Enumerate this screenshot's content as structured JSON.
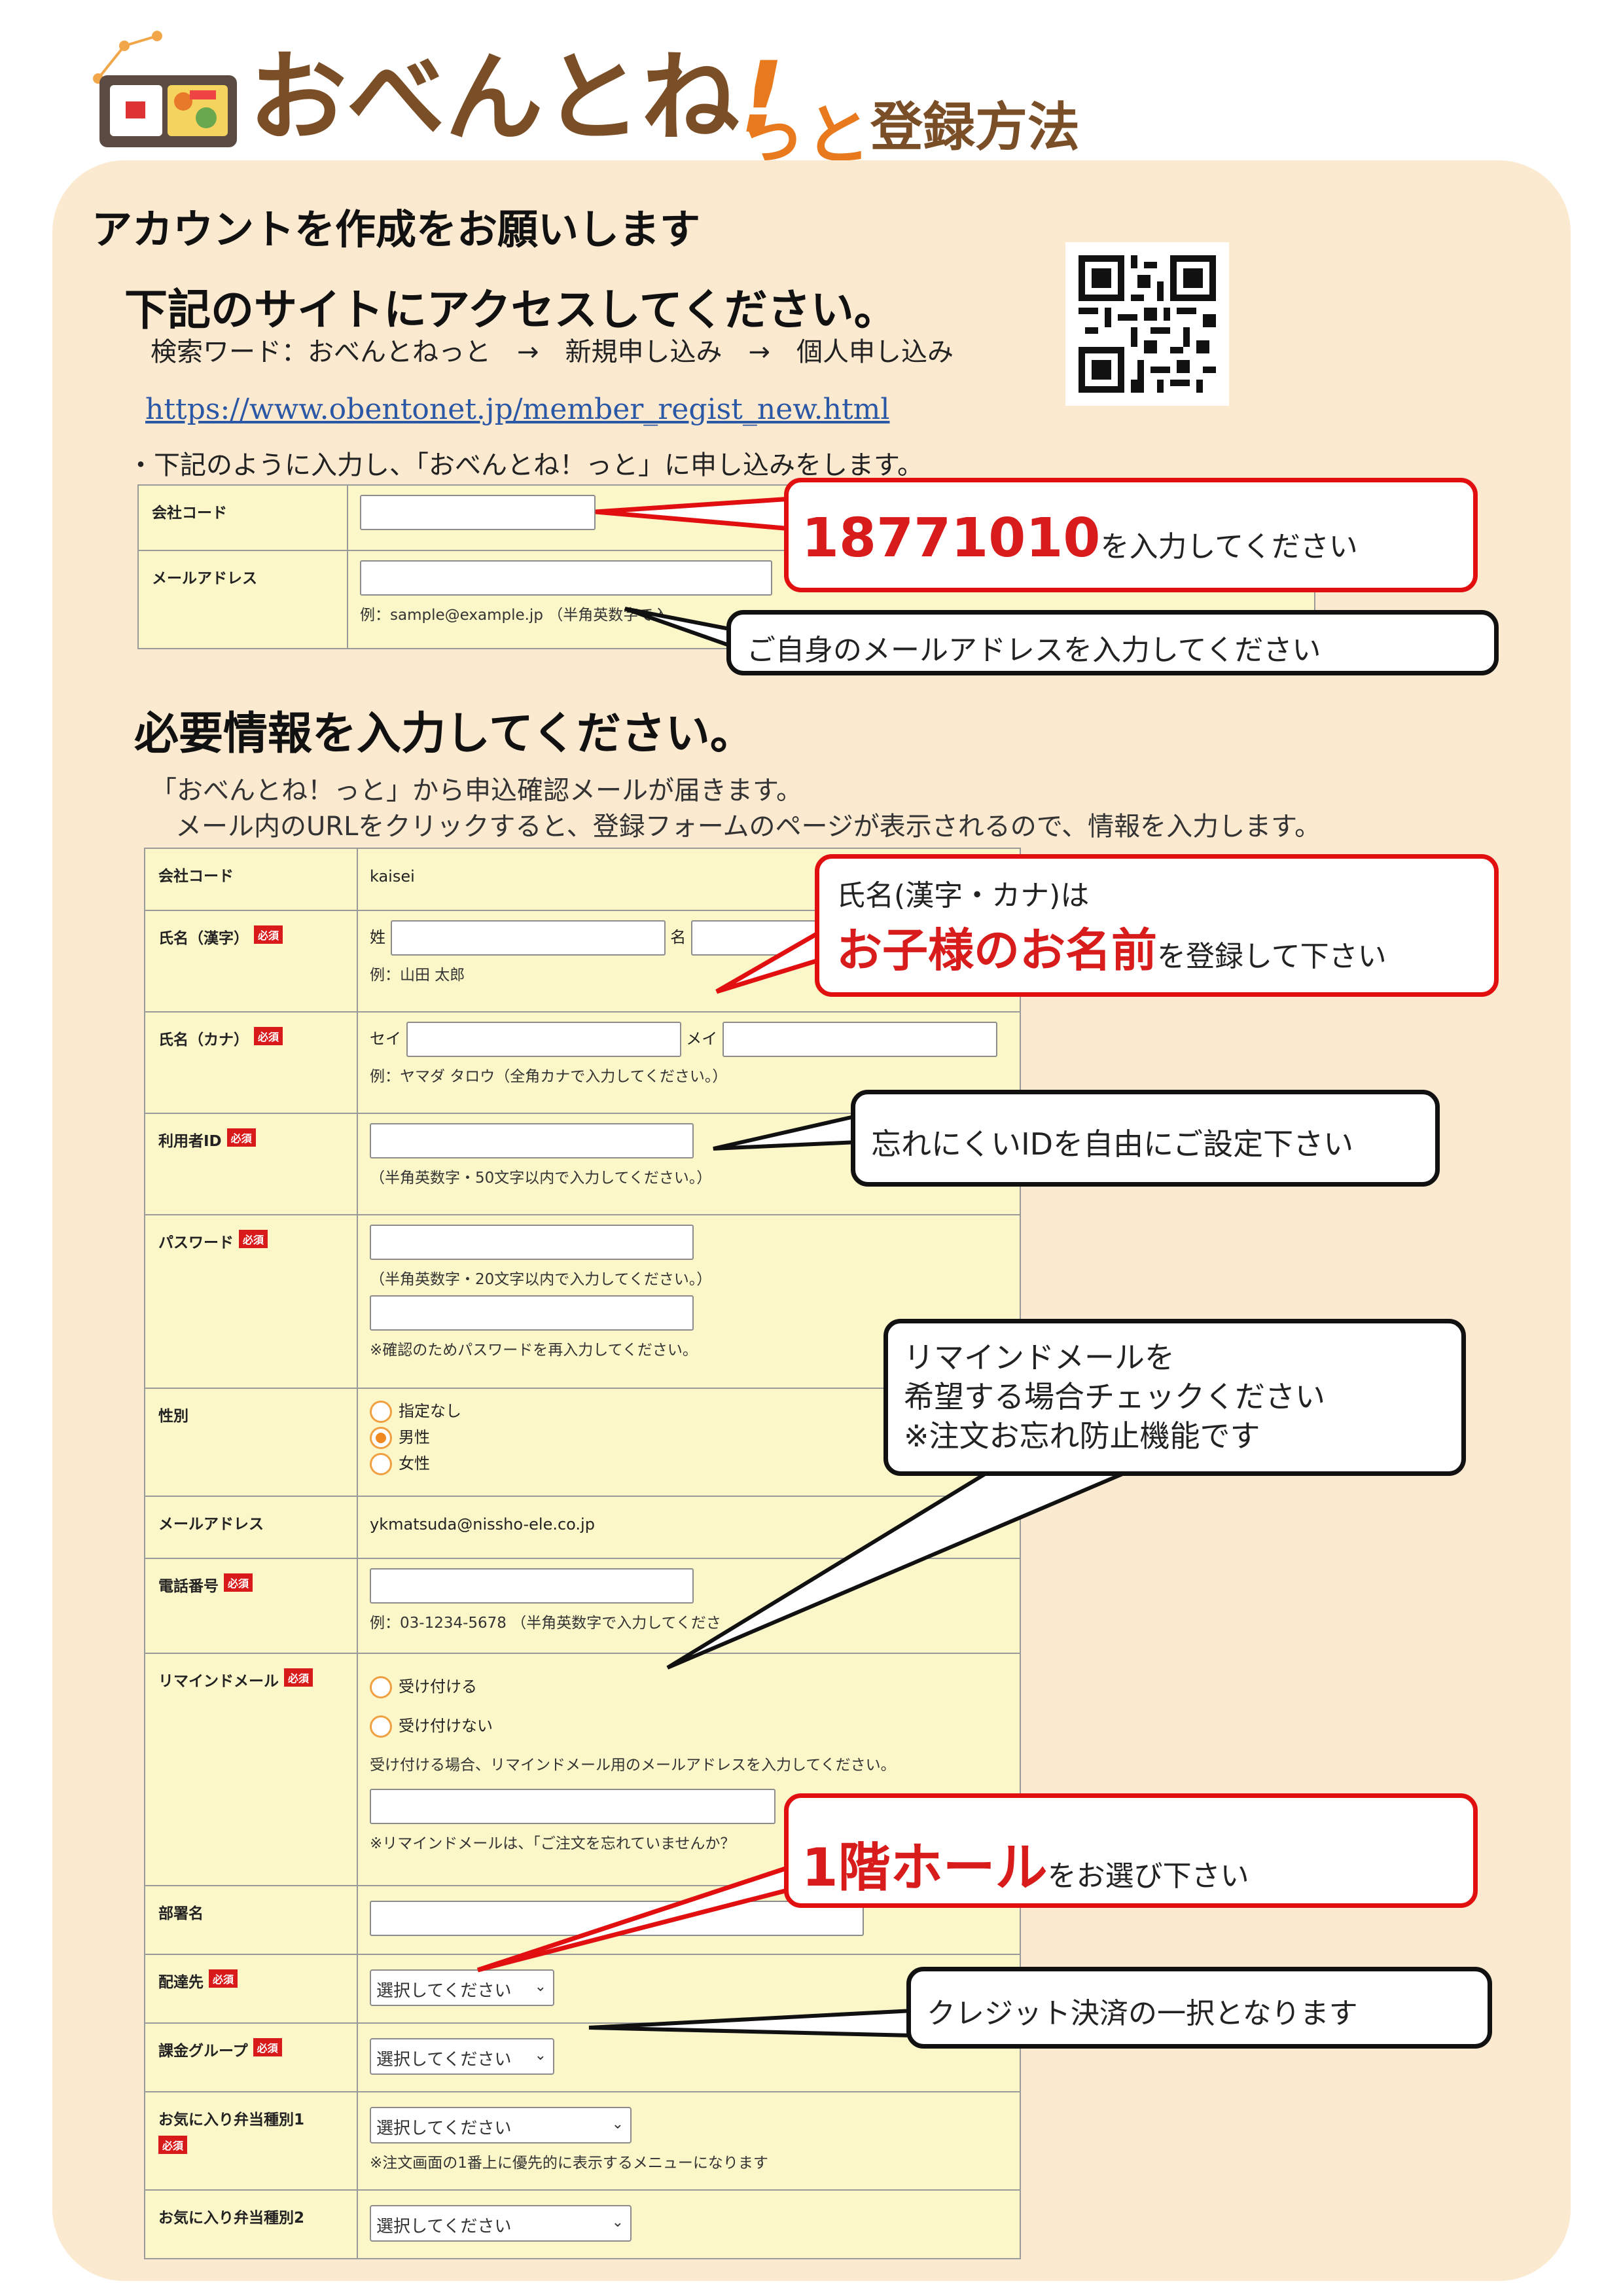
{
  "header": {
    "logo_main": "おべんとね",
    "logo_bang": "!",
    "logo_small": "っと",
    "logo_sub": "登録方法"
  },
  "section1": {
    "heading": "アカウントを作成をお願いします",
    "subheading": "下記のサイトにアクセスしてください。",
    "search_path": "検索ワード：おべんとねっと　→　新規申し込み　→　個人申し込み",
    "url": "https://www.obentonet.jp/member_regist_new.html",
    "instruction": "・下記のように入力し、「おべんとね！っと」に申し込みをします。"
  },
  "form1": {
    "company_code_label": "会社コード",
    "email_label": "メールアドレス",
    "email_hint": "例：sample@example.jp （半角英数字で入"
  },
  "callout_company": {
    "code": "18771010",
    "suffix": "を入力してください"
  },
  "callout_email": {
    "text": "ご自身のメールアドレスを入力してください"
  },
  "section2": {
    "heading": "必要情報を入力してください。",
    "line1": "「おべんとね！っと」から申込確認メールが届きます。",
    "line2": "メール内のURLをクリックすると、登録フォームのページが表示されるので、情報を入力します。"
  },
  "form2": {
    "required_badge": "必須",
    "company_code_label": "会社コード",
    "company_code_value": "kaisei",
    "name_kanji_label": "氏名（漢字）",
    "sei_label": "姓",
    "mei_label": "名",
    "name_kanji_hint": "例：山田 太郎",
    "name_kana_label": "氏名（カナ）",
    "sei_kana_label": "セイ",
    "mei_kana_label": "メイ",
    "name_kana_hint": "例：ヤマダ タロウ（全角カナで入力してください。）",
    "userid_label": "利用者ID",
    "userid_hint": "（半角英数字・50文字以内で入力してください。）",
    "password_label": "パスワード",
    "password_hint": "（半角英数字・20文字以内で入力してください。）",
    "password_confirm_hint": "※確認のためパスワードを再入力してください。",
    "gender_label": "性別",
    "gender_options": [
      "指定なし",
      "男性",
      "女性"
    ],
    "email_label": "メールアドレス",
    "email_value": "ykmatsuda@nissho-ele.co.jp",
    "phone_label": "電話番号",
    "phone_hint": "例：03-1234-5678 （半角英数字で入力してくださ",
    "remind_label": "リマインドメール",
    "remind_options": [
      "受け付ける",
      "受け付けない"
    ],
    "remind_hint": "受け付ける場合、リマインドメール用のメールアドレスを入力してください。",
    "remind_note": "※リマインドメールは、「ご注文を忘れていませんか？",
    "dept_label": "部署名",
    "delivery_label": "配達先",
    "billing_label": "課金グループ",
    "fav1_label": "お気に入り弁当種別1",
    "fav1_note": "※注文画面の1番上に優先的に表示するメニューになります",
    "fav2_label": "お気に入り弁当種別2",
    "select_placeholder": "選択してください"
  },
  "callout_name": {
    "line1": "氏名(漢字・カナ)は",
    "emph": "お子様のお名前",
    "suffix": "を登録して下さい"
  },
  "callout_id": {
    "text": "忘れにくいIDを自由にご設定下さい"
  },
  "callout_remind": {
    "line1": "リマインドメールを",
    "line2": "希望する場合チェックください",
    "line3": "※注文お忘れ防止機能です"
  },
  "callout_delivery": {
    "emph": "1階ホール",
    "suffix": "をお選び下さい"
  },
  "callout_billing": {
    "text": "クレジット決済の一択となります"
  },
  "colors": {
    "panel": "#fbe9d0",
    "red": "#e10f0f",
    "logo_brown": "#7a4e26",
    "logo_orange": "#e87a1d",
    "label_bg": "#fcf7c9"
  }
}
